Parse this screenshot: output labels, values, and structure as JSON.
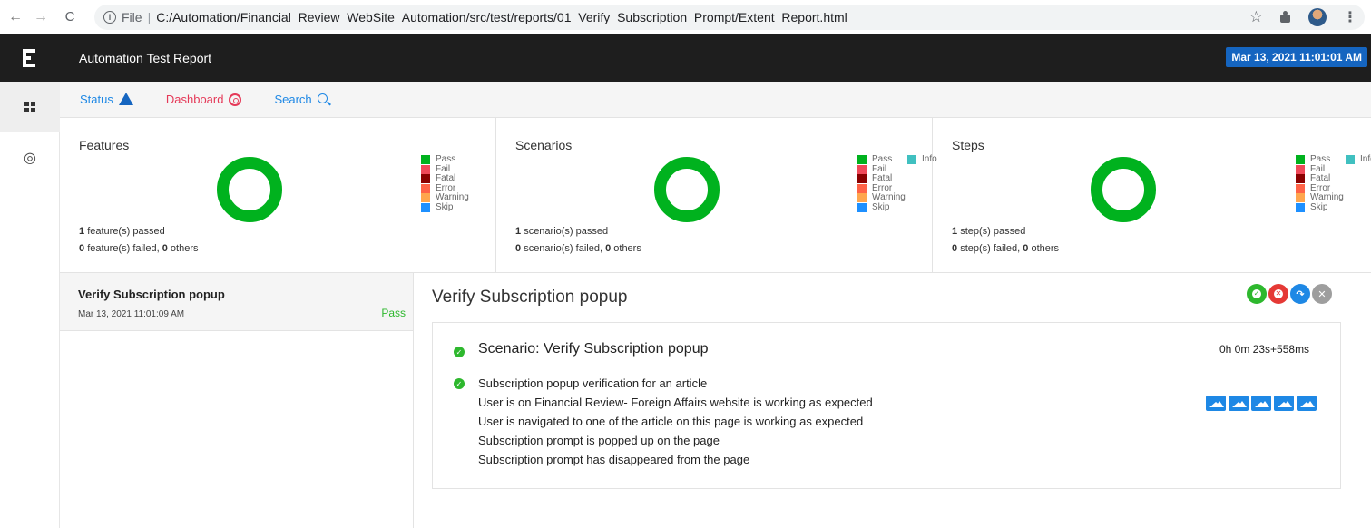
{
  "browser": {
    "file_label": "File",
    "separator": "|",
    "url": "C:/Automation/Financial_Review_WebSite_Automation/src/test/reports/01_Verify_Subscription_Prompt/Extent_Report.html",
    "back_glyph": "←",
    "forward_glyph": "→",
    "reload_glyph": "C",
    "star_glyph": "☆",
    "menu_glyph": "⋮"
  },
  "header": {
    "title": "Automation Test Report",
    "date": "Mar 13, 2021 11:01:01 AM"
  },
  "subnav": {
    "status": "Status",
    "dashboard": "Dashboard",
    "search": "Search"
  },
  "legend": {
    "pass": "Pass",
    "fail": "Fail",
    "fatal": "Fatal",
    "error": "Error",
    "warning": "Warning",
    "skip": "Skip",
    "info": "Info"
  },
  "colors": {
    "pass": "#00b21e",
    "fail": "#f04858",
    "fatal": "#8b0000",
    "error": "#ff6347",
    "warning": "#ffa64d",
    "skip": "#1e90ff",
    "info": "#40c0c0",
    "header": "#1e1e1e",
    "date_badge": "#1565c0"
  },
  "panels": [
    {
      "title": "Features",
      "pass_percent": 100,
      "passed_count": "1",
      "passed_text": "feature(s) passed",
      "failed_count": "0",
      "failed_text": "feature(s) failed,",
      "others_count": "0",
      "others_text": "others"
    },
    {
      "title": "Scenarios",
      "pass_percent": 100,
      "passed_count": "1",
      "passed_text": "scenario(s) passed",
      "failed_count": "0",
      "failed_text": "scenario(s) failed,",
      "others_count": "0",
      "others_text": "others"
    },
    {
      "title": "Steps",
      "pass_percent": 100,
      "passed_count": "1",
      "passed_text": "step(s) passed",
      "failed_count": "0",
      "failed_text": "step(s) failed,",
      "others_count": "0",
      "others_text": "others"
    }
  ],
  "tests": [
    {
      "name": "Verify Subscription popup",
      "time": "Mar 13, 2021 11:01:09 AM",
      "status": "Pass"
    }
  ],
  "detail": {
    "title": "Verify Subscription popup",
    "scenario_title": "Scenario: Verify Subscription popup",
    "duration": "0h 0m 23s+558ms",
    "steps": [
      "Subscription popup verification for an article",
      "User is on Financial Review- Foreign Affairs website is working as expected",
      "User is navigated to one of the article on this page is working as expected",
      "Subscription prompt is popped up on the page",
      "Subscription prompt has disappeared from the page"
    ],
    "screenshot_icons": [
      "image-icon",
      "image-icon",
      "image-icon",
      "image-icon",
      "image-icon"
    ]
  }
}
